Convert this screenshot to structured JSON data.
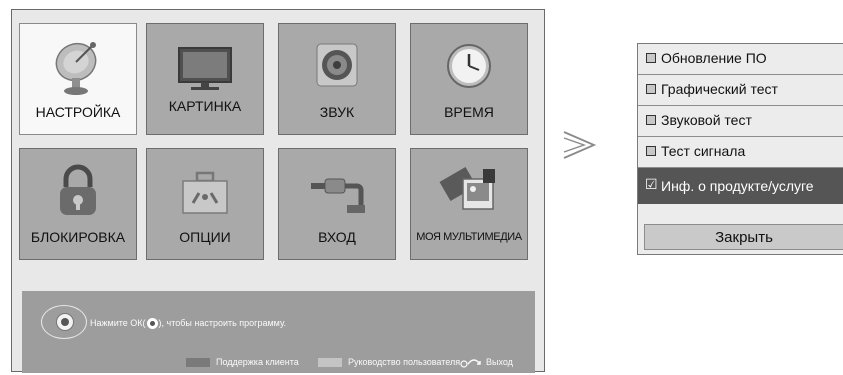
{
  "main_menu": {
    "tiles": [
      {
        "label": "НАСТРОЙКА",
        "icon": "satellite-dish-icon",
        "selected": true
      },
      {
        "label": "КАРТИНКА",
        "icon": "tv-icon",
        "selected": false
      },
      {
        "label": "ЗВУК",
        "icon": "speaker-icon",
        "selected": false
      },
      {
        "label": "ВРЕМЯ",
        "icon": "clock-icon",
        "selected": false
      },
      {
        "label": "БЛОКИРОВКА",
        "icon": "padlock-icon",
        "selected": false
      },
      {
        "label": "ОПЦИИ",
        "icon": "toolbox-icon",
        "selected": false
      },
      {
        "label": "ВХОД",
        "icon": "av-cable-icon",
        "selected": false
      },
      {
        "label": "МОЯ МУЛЬТИМЕДИА",
        "icon": "multimedia-icon",
        "selected": false
      }
    ],
    "help": {
      "text_before": "Нажмите ОК(",
      "text_after": "), чтобы настроить программу.",
      "legend": [
        {
          "label": "Поддержка клиента",
          "color": "#7a7a7a"
        },
        {
          "label": "Руководство пользователя",
          "color": "#c4c4c4"
        }
      ],
      "exit_label": "Выход"
    }
  },
  "arrow_icon": "double-chevron-right-icon",
  "support_menu": {
    "items": [
      {
        "label": "Обновление ПО",
        "checked": false
      },
      {
        "label": "Графический тест",
        "checked": false
      },
      {
        "label": "Звуковой тест",
        "checked": false
      },
      {
        "label": "Тест сигнала",
        "checked": false
      },
      {
        "label": "Инф. о продукте/услуге",
        "checked": true
      }
    ],
    "selected_check": "☑",
    "close_label": "Закрыть"
  },
  "colors": {
    "tile_bg": "#a9a9a9",
    "tile_selected_bg": "#f8f8f8",
    "menu_selected_bg": "#555555",
    "helpbar_bg": "#9d9d9d"
  }
}
